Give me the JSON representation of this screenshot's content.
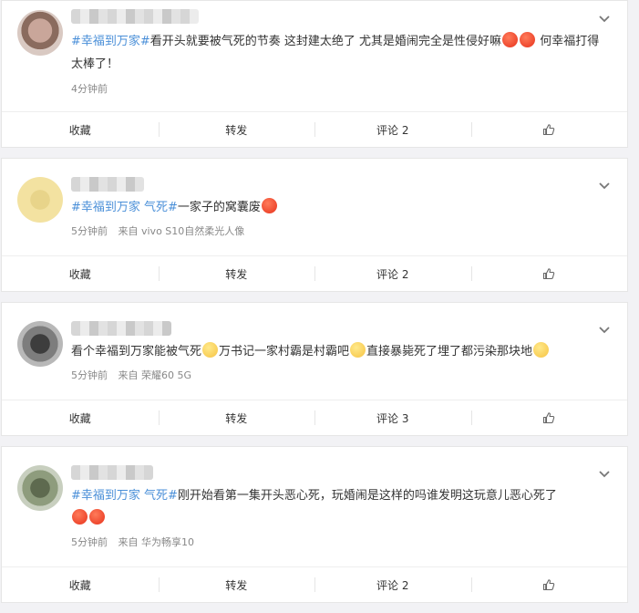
{
  "comments": [
    {
      "topic": "#幸福到万家#",
      "text": "看开头就要被气死的节奏 这封建太绝了 尤其是婚闹完全是性侵好嘛",
      "text_after": "何幸福打得太棒了！",
      "time": "4分钟前",
      "device": "",
      "comments_count": "评论 2"
    },
    {
      "topic": "#幸福到万家 气死#",
      "text": "一家子的窝囊废",
      "time": "5分钟前",
      "device": "来自 vivo S10自然柔光人像",
      "comments_count": "评论 2"
    },
    {
      "topic": "",
      "text_parts": [
        "看个幸福到万家能被气死",
        "万书记一家村霸是村霸吧",
        "直接暴毙死了埋了都污染那块地"
      ],
      "time": "5分钟前",
      "device": "来自 荣耀60 5G",
      "comments_count": "评论 3"
    },
    {
      "topic": "#幸福到万家 气死#",
      "text": "刚开始看第一集开头恶心死，玩婚闹是这样的吗谁发明这玩意儿恶心死了",
      "time": "5分钟前",
      "device": "来自 华为畅享10",
      "comments_count": "评论 2"
    }
  ],
  "actions": {
    "favorite": "收藏",
    "repost": "转发"
  },
  "icons": {
    "collapse": "chevron-down-icon",
    "like": "thumbs-up-icon"
  },
  "colors": {
    "topic": "#4a8fd8",
    "background": "#f2f2f5"
  }
}
